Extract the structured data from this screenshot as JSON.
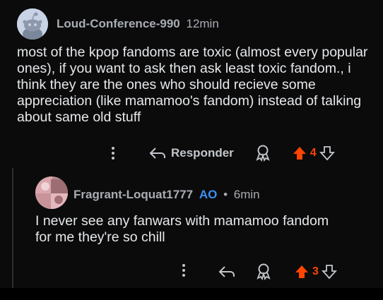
{
  "comment": {
    "username": "Loud-Conference-990",
    "time": "12min",
    "body": "most of the kpop fandoms are toxic (almost every popular ones), if you want to ask then ask least toxic fandom., i think they are the ones who should recieve some appreciation (like mamamoo's fandom) instead of talking about same old stuff",
    "reply_label": "Responder",
    "score": "4"
  },
  "reply": {
    "username": "Fragrant-Loquat1777",
    "badge": "AO",
    "separator": "•",
    "time": "6min",
    "body_line1": "I never see any fanwars with mamamoo fandom",
    "body_line2": "for me they're so chill",
    "score": "3"
  },
  "icons": {
    "more": "more-vertical-icon",
    "reply": "reply-arrow-icon",
    "award": "award-icon",
    "upvote": "upvote-arrow-icon",
    "downvote": "downvote-arrow-icon"
  },
  "colors": {
    "background": "#0b0b0c",
    "upvote_active": "#ff4500",
    "op_badge": "#3d8ff5",
    "text": "#e6e8ea",
    "meta": "#a9adb2"
  }
}
